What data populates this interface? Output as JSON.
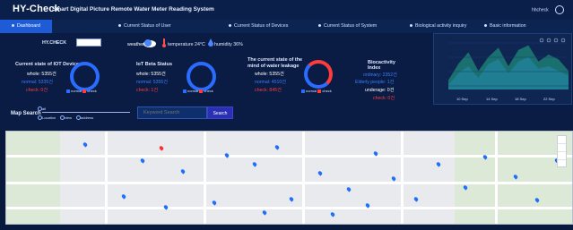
{
  "app": {
    "logo": "HY-Check",
    "title": "Smart Digital Picture Remote Water Meter Reading System",
    "user": "hhcheck",
    "settings_icon": "gear-icon"
  },
  "nav": {
    "tabs": [
      {
        "label": "Dashboard",
        "active": true
      },
      {
        "label": "Current Status of User"
      },
      {
        "label": "Current Status of Devices"
      },
      {
        "label": "Current Status of System"
      },
      {
        "label": "Biological activity inquiry"
      },
      {
        "label": "Basic information"
      }
    ]
  },
  "weather": {
    "location_label": "HY.CHECK",
    "condition": "weather",
    "temperature": "temperature 24°C",
    "humidity": "humidity 36%"
  },
  "cards": [
    {
      "title": "Current state of IOT Devices",
      "lines": [
        {
          "text": "whole: 5355건",
          "color": "white"
        },
        {
          "text": "normal: 5335건",
          "color": "blue"
        },
        {
          "text": "check: 0건",
          "color": "red"
        }
      ],
      "legend": [
        "normal",
        "check"
      ]
    },
    {
      "title": "IoT Beta Status",
      "lines": [
        {
          "text": "whole: 5355건",
          "color": "white"
        },
        {
          "text": "normal: 5355건",
          "color": "blue"
        },
        {
          "text": "check: 1건",
          "color": "red"
        }
      ],
      "legend": [
        "normal",
        "check"
      ]
    },
    {
      "title": "The current state of the mind of water leakage",
      "lines": [
        {
          "text": "whole: 5355건",
          "color": "white"
        },
        {
          "text": "normal: 4510건",
          "color": "blue"
        },
        {
          "text": "check: 845건",
          "color": "red"
        }
      ],
      "legend": [
        "normal",
        "check"
      ]
    },
    {
      "title": "Biocactivity Index",
      "lines": [
        {
          "text": "ordinary: 2352건",
          "color": "blue"
        },
        {
          "text": "Elderly people: 1건",
          "color": "white"
        },
        {
          "text": "underage: 0건",
          "color": "white"
        },
        {
          "text": "check: 0건",
          "color": "red"
        }
      ]
    }
  ],
  "map_search": {
    "label": "Map Search",
    "options": [
      "all",
      "Location",
      "view",
      "address"
    ],
    "search_placeholder": "Keyword Search",
    "search_button": "Search"
  },
  "chart_data": {
    "type": "area",
    "x": [
      "10 Sep",
      "14 Sep",
      "18 Sep",
      "22 Sep"
    ],
    "series": [
      {
        "values": [
          0.2,
          0.55,
          0.8,
          0.4,
          0.7,
          0.9,
          0.5,
          0.85,
          0.95,
          0.6,
          0.75,
          0.65,
          0.4
        ]
      },
      {
        "values": [
          0.1,
          0.35,
          0.5,
          0.25,
          0.55,
          0.65,
          0.35,
          0.6,
          0.7,
          0.45,
          0.5,
          0.4,
          0.3
        ]
      }
    ],
    "ylim": [
      0,
      1
    ]
  }
}
